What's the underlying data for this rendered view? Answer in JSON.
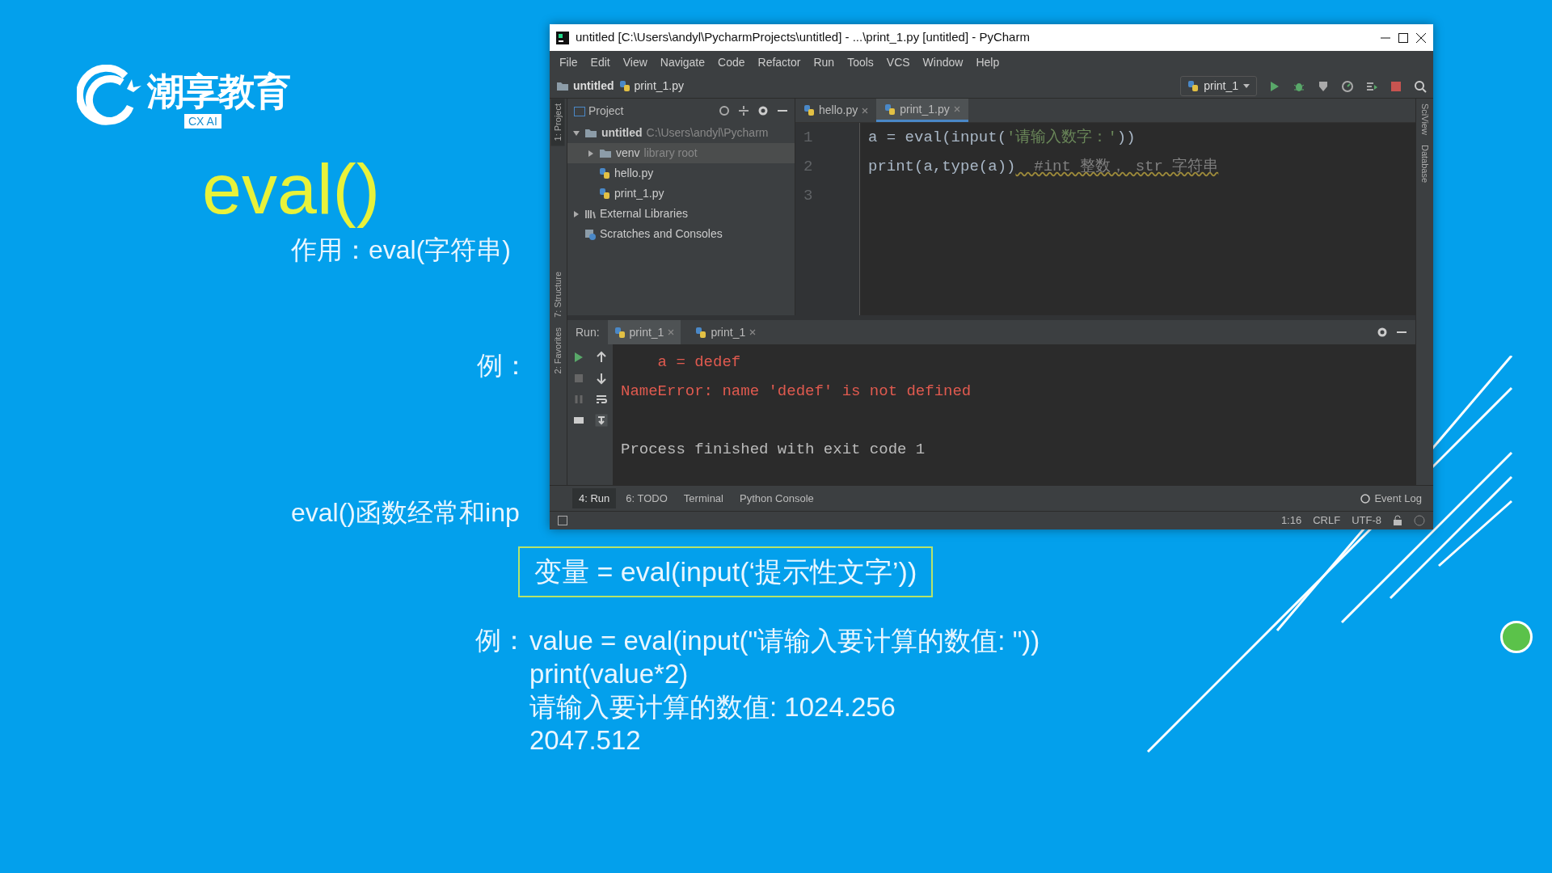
{
  "slide": {
    "logo": {
      "name": "潮享教育",
      "tag": "CX AI"
    },
    "title": "eval()",
    "lines": [
      {
        "kind": "text",
        "text": "作用：eval(字符串)"
      },
      {
        "kind": "example",
        "text": "例："
      },
      {
        "kind": "text",
        "text": "eval()函数经常和inp"
      }
    ],
    "formula": "变量 = eval(input(‘提示性文字’))",
    "example_label": "例：",
    "example_lines": [
      "value = eval(input(\"请输入要计算的数值: \"))",
      "print(value*2)",
      "请输入要计算的数值: 1024.256",
      "2047.512"
    ]
  },
  "window": {
    "title": "untitled [C:\\Users\\andyl\\PycharmProjects\\untitled] - ...\\print_1.py [untitled] - PyCharm"
  },
  "menu": [
    "File",
    "Edit",
    "View",
    "Navigate",
    "Code",
    "Refactor",
    "Run",
    "Tools",
    "VCS",
    "Window",
    "Help"
  ],
  "breadcrumbs": [
    "untitled",
    "print_1.py"
  ],
  "run_config": "print_1",
  "left_strip": [
    {
      "label": "1: Project",
      "selected": true
    },
    {
      "label": "7: Structure",
      "selected": false
    },
    {
      "label": "2: Favorites",
      "selected": false
    }
  ],
  "right_strip": [
    "SciView",
    "Database"
  ],
  "project": {
    "title": "Project",
    "tree": [
      {
        "label": "untitled",
        "hint": "C:\\Users\\andyl\\Pycharm",
        "kind": "folder",
        "expanded": true,
        "selected": false,
        "children": [
          {
            "label": "venv",
            "hint": "library root",
            "kind": "folder",
            "expanded": false,
            "selected": true
          },
          {
            "label": "hello.py",
            "kind": "file",
            "selected": false
          },
          {
            "label": "print_1.py",
            "kind": "file",
            "selected": false
          }
        ]
      },
      {
        "label": "External Libraries",
        "kind": "library",
        "expanded": false,
        "selected": false
      },
      {
        "label": "Scratches and Consoles",
        "kind": "scratch",
        "selected": false
      }
    ]
  },
  "editor_tabs": [
    {
      "label": "hello.py",
      "selected": false
    },
    {
      "label": "print_1.py",
      "selected": true
    }
  ],
  "code": [
    {
      "number": "1",
      "tokens": [
        {
          "kind": "plain",
          "text": "a = eval(input("
        },
        {
          "kind": "string",
          "text": "'请输入数字：'"
        },
        {
          "kind": "plain",
          "text": "))"
        }
      ]
    },
    {
      "number": "2",
      "tokens": [
        {
          "kind": "plain",
          "text": "print(a,type(a))"
        },
        {
          "kind": "comment",
          "text": "  #int 整数， str 字符串"
        }
      ]
    },
    {
      "number": "3"
    }
  ],
  "run": {
    "label": "Run:",
    "tabs": [
      {
        "label": "print_1",
        "selected": true
      },
      {
        "label": "print_1",
        "selected": false
      }
    ],
    "console": [
      {
        "kind": "error",
        "text": "    a = dedef"
      },
      {
        "kind": "error",
        "text": "NameError: name 'dedef' is not defined"
      },
      {
        "kind": "blank"
      },
      {
        "kind": "normal",
        "text": "Process finished with exit code 1"
      }
    ]
  },
  "tool_tabs": [
    {
      "label": "4: Run",
      "selected": true
    },
    {
      "label": "6: TODO",
      "selected": false
    },
    {
      "label": "Terminal",
      "selected": false
    },
    {
      "label": "Python Console",
      "selected": false
    }
  ],
  "event_log": "Event Log",
  "status_bar": [
    "1:16",
    "CRLF",
    "UTF-8"
  ]
}
